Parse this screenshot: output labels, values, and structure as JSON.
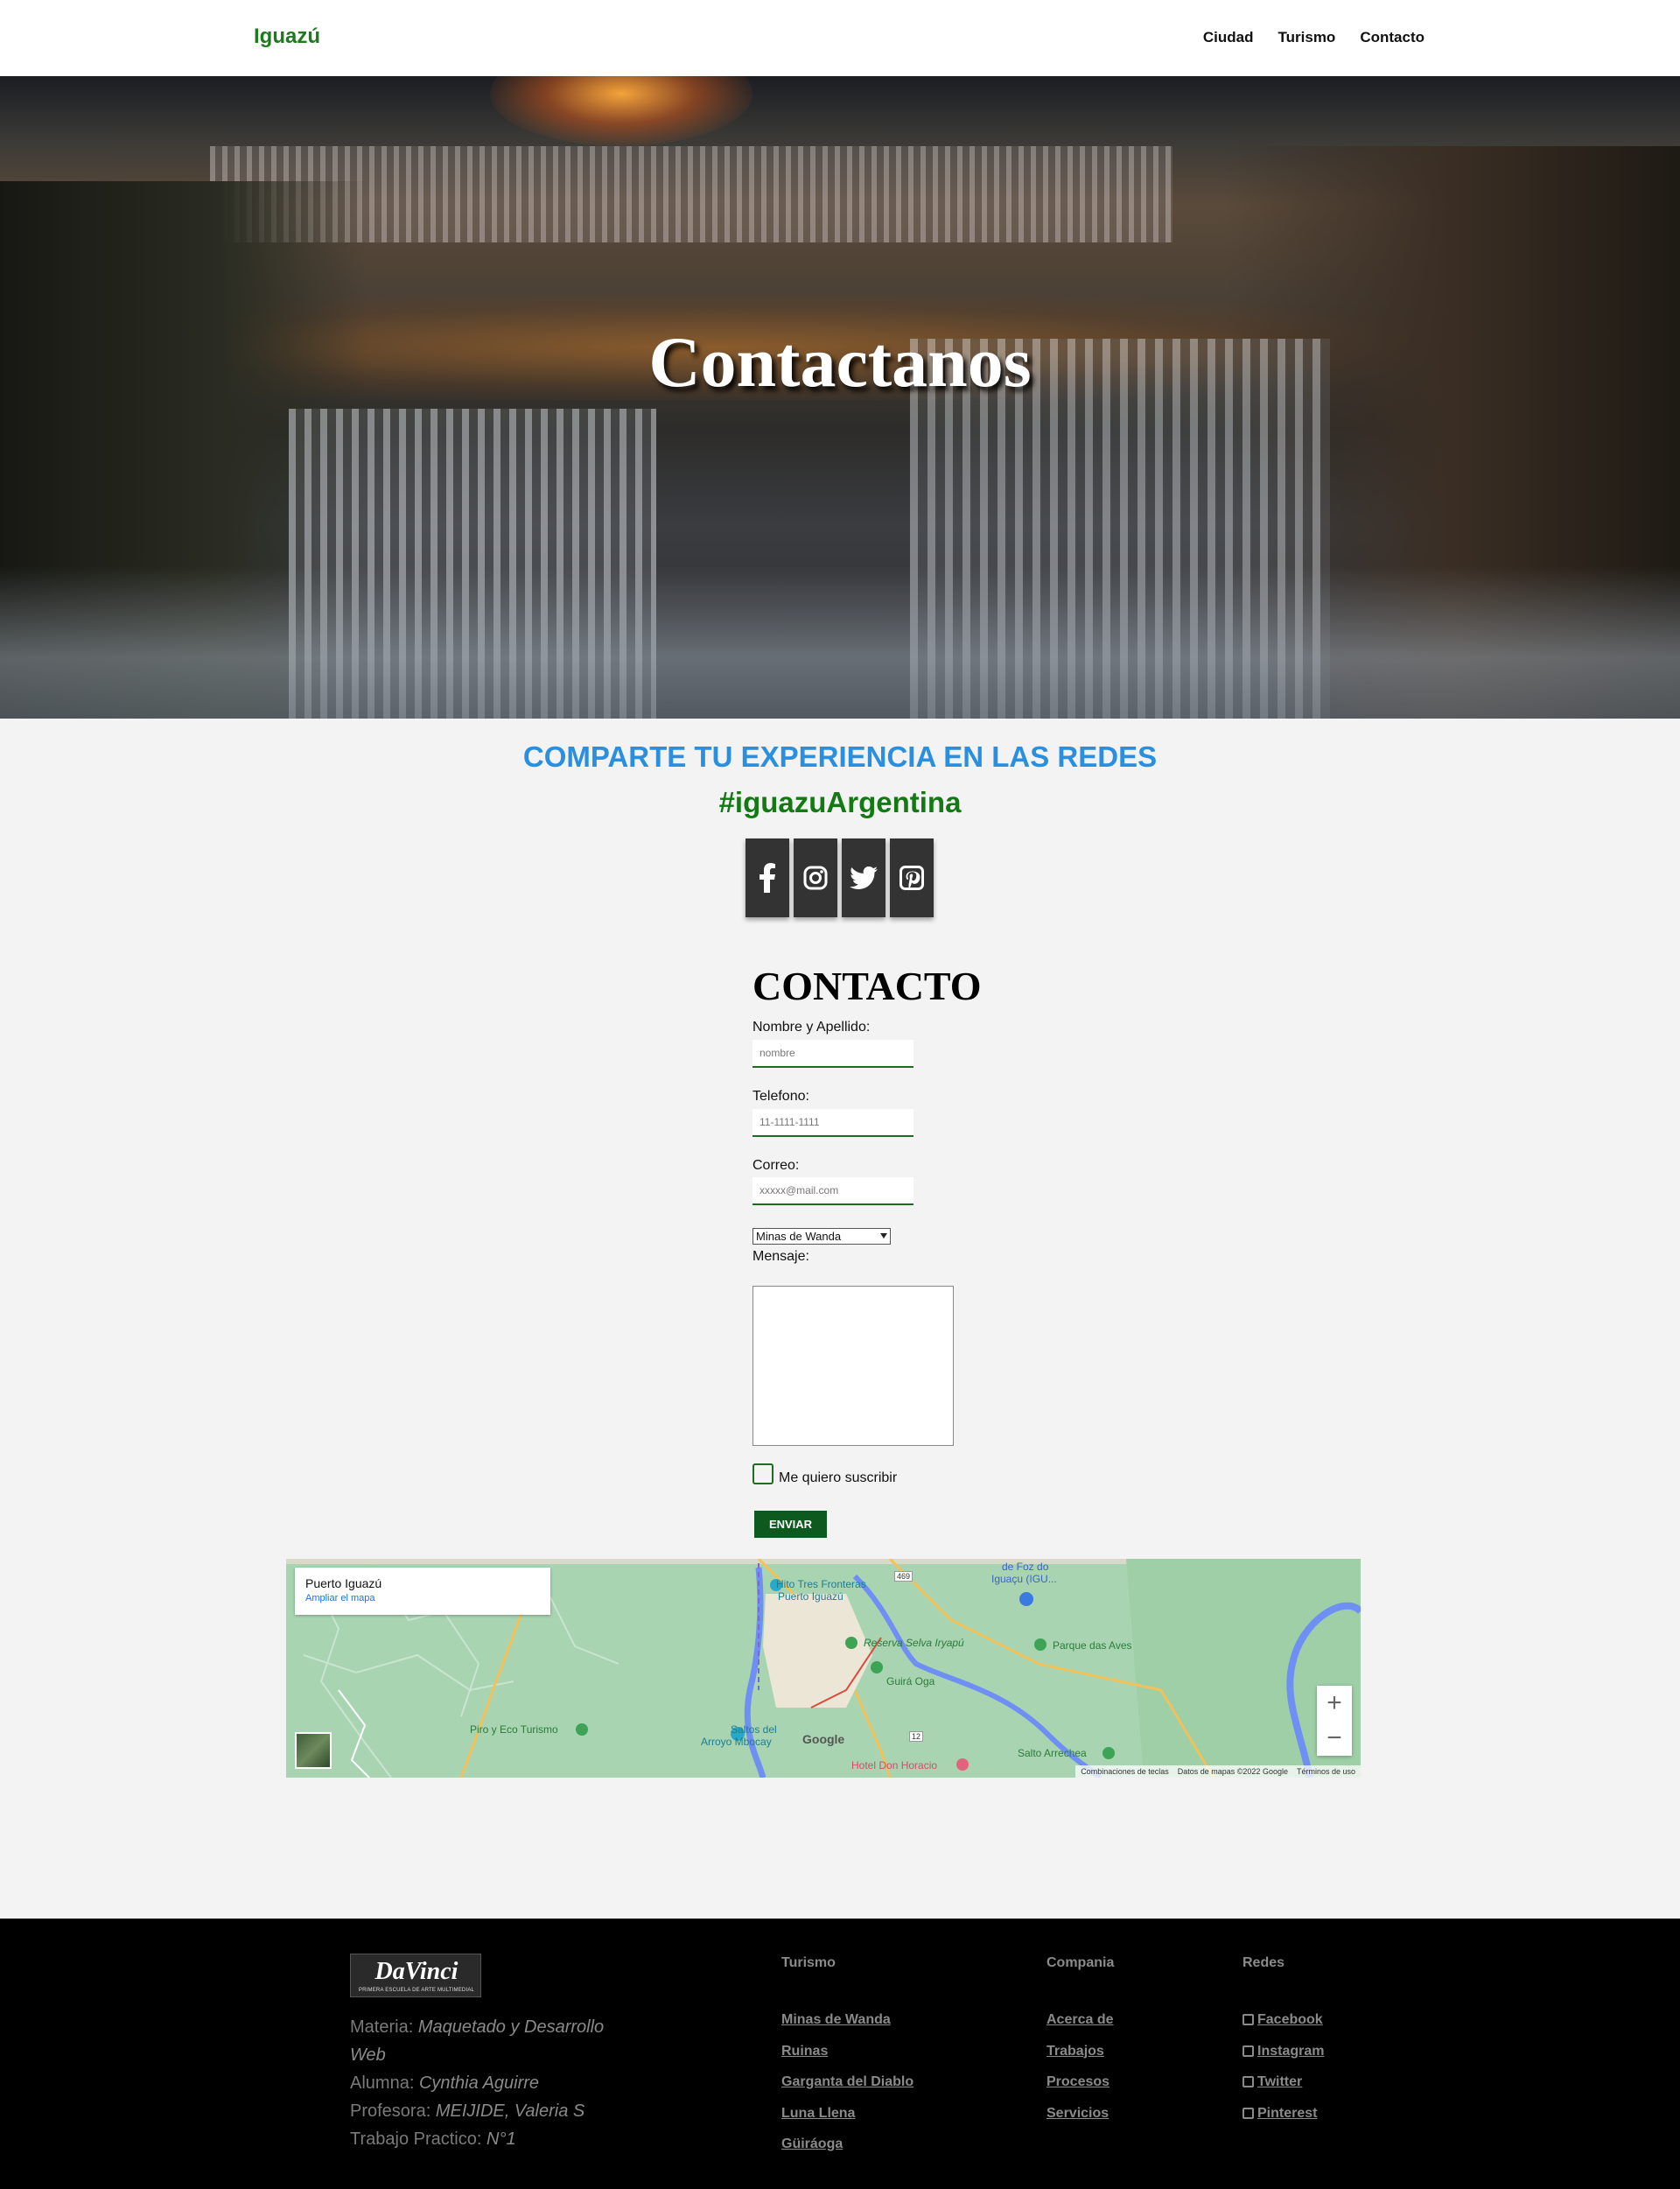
{
  "nav": {
    "brand": "Iguazú",
    "links": [
      "Ciudad",
      "Turismo",
      "Contacto"
    ]
  },
  "hero": {
    "title": "Contactanos"
  },
  "social": {
    "share_text": "COMPARTE TU EXPERIENCIA EN LAS REDES",
    "hashtag": "#iguazuArgentina",
    "icons": [
      "facebook-icon",
      "instagram-icon",
      "twitter-icon",
      "pinterest-icon"
    ]
  },
  "form": {
    "title": "CONTACTO",
    "name_label": "Nombre y Apellido:",
    "name_placeholder": "nombre",
    "phone_label": "Telefono:",
    "phone_placeholder": "11-1111-1111",
    "email_label": "Correo:",
    "email_placeholder": "xxxxx@mail.com",
    "select_value": "Minas de Wanda",
    "message_label": "Mensaje:",
    "subscribe_label": "Me quiero suscribir",
    "submit_label": "ENVIAR"
  },
  "map": {
    "place": "Puerto Iguazú",
    "enlarge_link": "Ampliar el mapa",
    "labels": {
      "hito": "Hito Tres Fronteras",
      "puerto": "Puerto Iguazú",
      "foz": "de Foz do",
      "foz2": "Iguaçu (IGU...",
      "reserva": "Reserva Selva Iryapú",
      "guira": "Guirá Oga",
      "parque": "Parque das Aves",
      "piro": "Piro y Eco Turismo",
      "saltos": "Saltos del",
      "arroyo": "Arroyo Mbocay",
      "hotel": "Hotel Don Horacio",
      "salto": "Salto Arrechea",
      "r469": "469",
      "r12": "12"
    },
    "zoom_in": "+",
    "zoom_out": "−",
    "google": "Google",
    "footer": [
      "Combinaciones de teclas",
      "Datos de mapas ©2022 Google",
      "Términos de uso"
    ]
  },
  "footer": {
    "logo_text": "DaVinci",
    "logo_sub": "PRIMERA ESCUELA DE ARTE MULTIMEDIAL",
    "credits": [
      {
        "label": "Materia: ",
        "value": "Maquetado y Desarrollo Web"
      },
      {
        "label": "Alumna: ",
        "value": "Cynthia Aguirre"
      },
      {
        "label": "Profesora: ",
        "value": "MEIJIDE, Valeria S"
      },
      {
        "label": "Trabajo Practico: ",
        "value": "N°1"
      }
    ],
    "turismo": {
      "heading": "Turismo",
      "items": [
        "Minas de Wanda",
        "Ruinas",
        "Garganta del Diablo",
        "Luna Llena",
        "Güiráoga"
      ]
    },
    "compania": {
      "heading": "Compania",
      "items": [
        "Acerca de",
        "Trabajos",
        "Procesos",
        "Servicios"
      ]
    },
    "redes": {
      "heading": "Redes",
      "items": [
        "Facebook",
        "Instagram",
        "Twitter",
        "Pinterest"
      ]
    }
  },
  "colors": {
    "brand_green": "#1f7a1f",
    "share_blue": "#2b8fe0",
    "button_green": "#0e5a1e"
  }
}
